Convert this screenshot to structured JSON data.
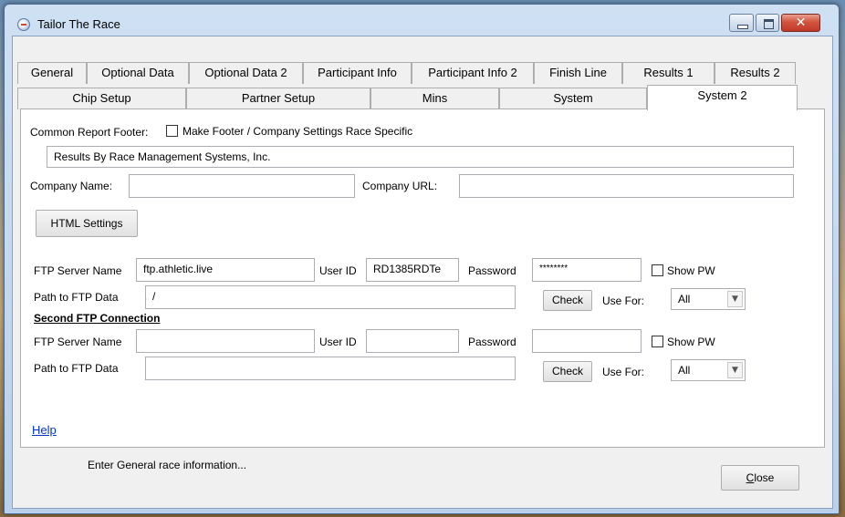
{
  "window": {
    "title": "Tailor The Race"
  },
  "tabs_row1": [
    "General",
    "Optional Data",
    "Optional Data 2",
    "Participant Info",
    "Participant Info 2",
    "Finish Line",
    "Results 1",
    "Results 2"
  ],
  "tabs_row2": [
    "Chip Setup",
    "Partner Setup",
    "Mins",
    "System",
    "System 2"
  ],
  "active_tab": "System 2",
  "footer": {
    "label": "Common Report Footer:",
    "checkbox_label": "Make Footer / Company Settings Race Specific",
    "text": "Results By Race Management Systems, Inc."
  },
  "company": {
    "name_label": "Company Name:",
    "name_value": "",
    "url_label": "Company URL:",
    "url_value": ""
  },
  "html_settings_label": "HTML Settings",
  "ftp1": {
    "server_label": "FTP Server Name",
    "server_value": "ftp.athletic.live",
    "user_label": "User ID",
    "user_value": "RD1385RDTe",
    "password_label": "Password",
    "password_value": "********",
    "show_pw_label": "Show PW",
    "path_label": "Path to FTP Data",
    "path_value": "/",
    "check_label": "Check",
    "use_for_label": "Use For:",
    "use_for_value": "All"
  },
  "ftp2": {
    "heading": "Second FTP Connection",
    "server_label": "FTP Server Name",
    "server_value": "",
    "user_label": "User ID",
    "user_value": "",
    "password_label": "Password",
    "password_value": "",
    "show_pw_label": "Show PW",
    "path_label": "Path to FTP Data",
    "path_value": "",
    "check_label": "Check",
    "use_for_label": "Use For:",
    "use_for_value": "All"
  },
  "help_label": "Help",
  "status_text": "Enter General race information...",
  "close_label": "Close",
  "close_mnemonic": "C",
  "close_rest": "lose"
}
